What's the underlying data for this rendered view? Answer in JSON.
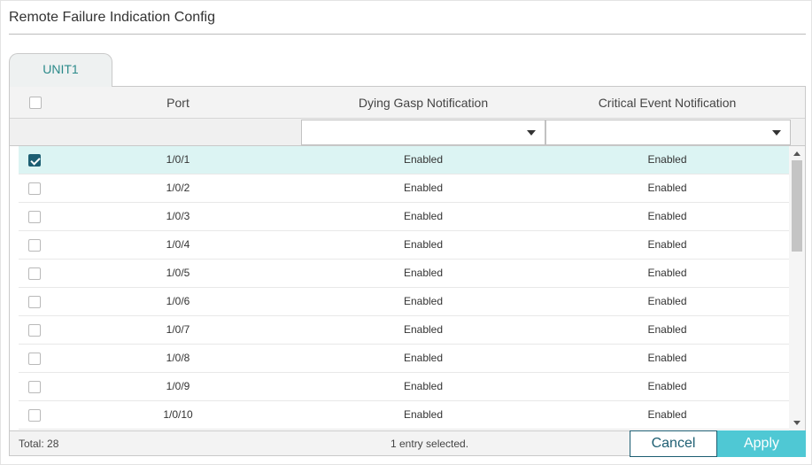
{
  "panel": {
    "title": "Remote Failure Indication Config"
  },
  "tabs": [
    {
      "label": "UNIT1"
    }
  ],
  "table": {
    "columns": {
      "port": "Port",
      "dying_gasp": "Dying Gasp Notification",
      "critical_event": "Critical Event Notification"
    },
    "filters": {
      "dying_gasp": "",
      "critical_event": ""
    },
    "rows": [
      {
        "port": "1/0/1",
        "dying_gasp": "Enabled",
        "critical_event": "Enabled",
        "checked": true
      },
      {
        "port": "1/0/2",
        "dying_gasp": "Enabled",
        "critical_event": "Enabled",
        "checked": false
      },
      {
        "port": "1/0/3",
        "dying_gasp": "Enabled",
        "critical_event": "Enabled",
        "checked": false
      },
      {
        "port": "1/0/4",
        "dying_gasp": "Enabled",
        "critical_event": "Enabled",
        "checked": false
      },
      {
        "port": "1/0/5",
        "dying_gasp": "Enabled",
        "critical_event": "Enabled",
        "checked": false
      },
      {
        "port": "1/0/6",
        "dying_gasp": "Enabled",
        "critical_event": "Enabled",
        "checked": false
      },
      {
        "port": "1/0/7",
        "dying_gasp": "Enabled",
        "critical_event": "Enabled",
        "checked": false
      },
      {
        "port": "1/0/8",
        "dying_gasp": "Enabled",
        "critical_event": "Enabled",
        "checked": false
      },
      {
        "port": "1/0/9",
        "dying_gasp": "Enabled",
        "critical_event": "Enabled",
        "checked": false
      },
      {
        "port": "1/0/10",
        "dying_gasp": "Enabled",
        "critical_event": "Enabled",
        "checked": false
      }
    ]
  },
  "footer": {
    "total": "Total: 28",
    "status": "1 entry selected.",
    "cancel_label": "Cancel",
    "apply_label": "Apply"
  },
  "colors": {
    "accent": "#4fc8d4",
    "dark_accent": "#1d5e72",
    "selected_row": "#dcf4f3",
    "tab_text": "#2b8a8a"
  },
  "icons": {
    "dropdown": "caret-down-icon",
    "checkbox": "checkbox-icon"
  }
}
